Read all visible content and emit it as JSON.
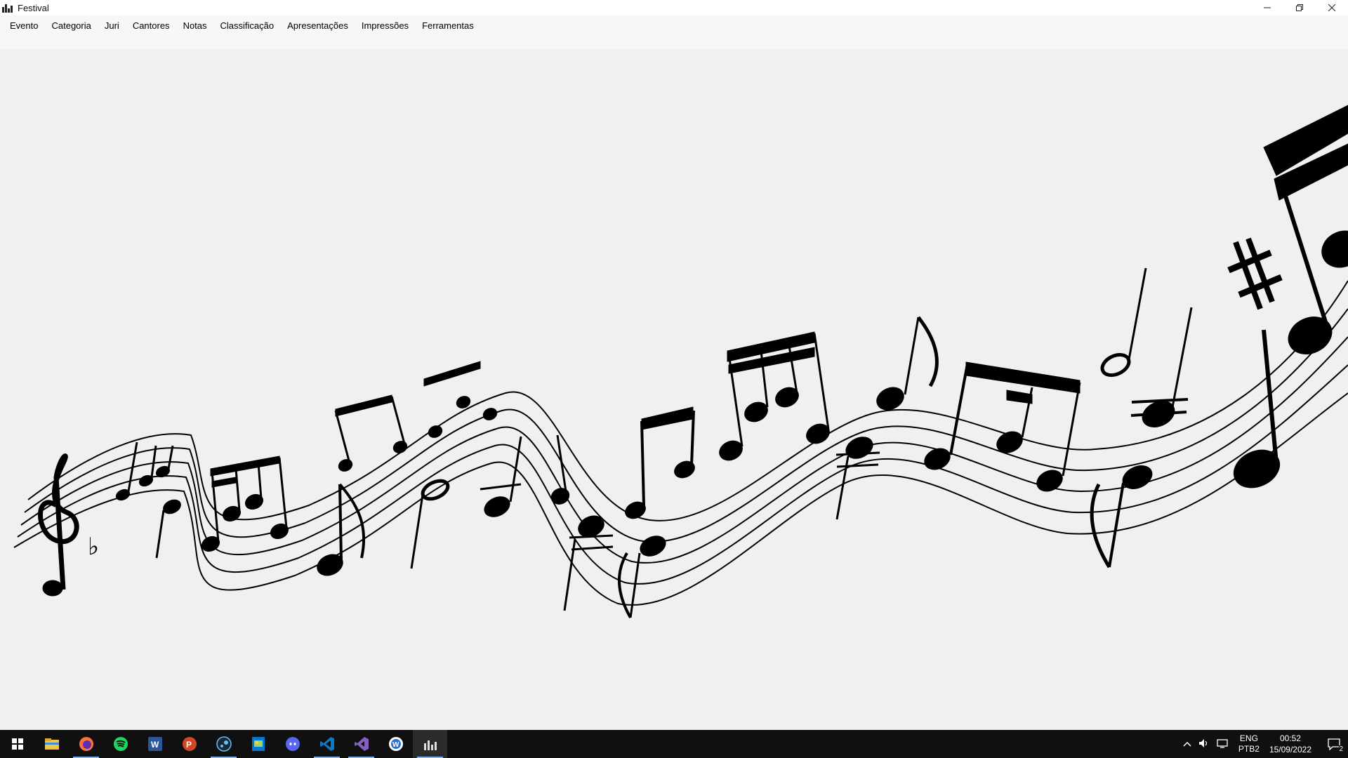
{
  "window": {
    "title": "Festival"
  },
  "menu": {
    "items": [
      "Evento",
      "Categoria",
      "Juri",
      "Cantores",
      "Notas",
      "Classificação",
      "Apresentações",
      "Impressões",
      "Ferramentas"
    ]
  },
  "taskbar": {
    "apps": [
      "windows-start-icon",
      "file-explorer-icon",
      "firefox-icon",
      "spotify-icon",
      "word-icon",
      "powerpoint-icon",
      "steam-icon",
      "image-viewer-icon",
      "discord-icon",
      "vscode-icon",
      "visual-studio-icon",
      "wps-icon",
      "festival-app-icon"
    ],
    "lang_top": "ENG",
    "lang_bottom": "PTB2",
    "time": "00:52",
    "date": "15/09/2022",
    "notification_count": "2"
  },
  "colors": {
    "taskbar": "#101010",
    "background": "#f0f0f0",
    "accent": "#7fb2e8"
  }
}
